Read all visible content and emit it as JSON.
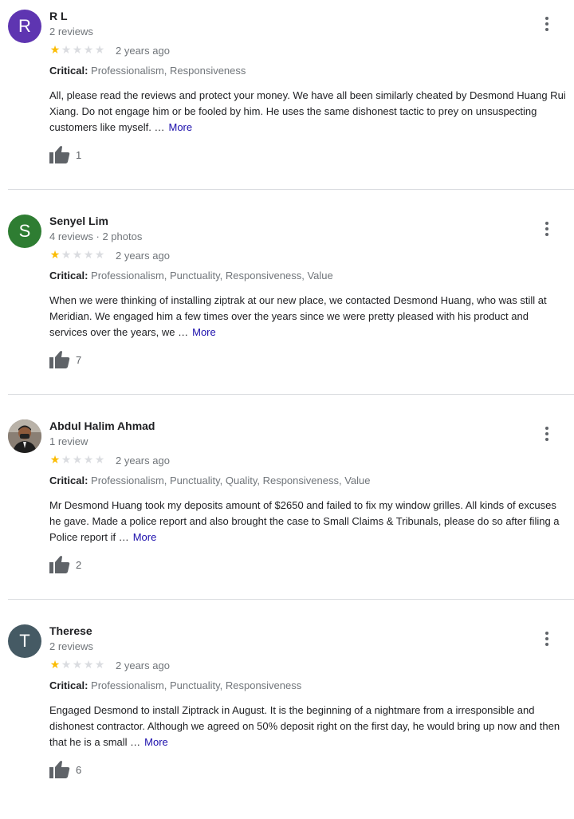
{
  "reviews": [
    {
      "avatar_letter": "R",
      "avatar_color": "#5e35b1",
      "name": "R L",
      "meta": "2 reviews",
      "rating": 1,
      "max_rating": 5,
      "time": "2 years ago",
      "critical_label": "Critical:",
      "critical_items": "Professionalism, Responsiveness",
      "text": "All, please read the reviews and protect your money. We have all been similarly cheated by Desmond Huang Rui Xiang. Do not engage him or be fooled by him. He uses the same dishonest tactic to prey on unsuspecting customers like myself. …",
      "more": "More",
      "likes": "1"
    },
    {
      "avatar_letter": "S",
      "avatar_color": "#2e7d32",
      "name": "Senyel Lim",
      "meta": "4 reviews · 2 photos",
      "rating": 1,
      "max_rating": 5,
      "time": "2 years ago",
      "critical_label": "Critical:",
      "critical_items": "Professionalism, Punctuality, Responsiveness, Value",
      "text": "When we were thinking of installing ziptrak at our new place, we contacted Desmond Huang, who was still at Meridian. We engaged him a few times over the years since we were pretty pleased with his product and services over the years, we …",
      "more": "More",
      "likes": "7"
    },
    {
      "avatar_letter": "",
      "avatar_color": "#6d6d6d",
      "name": "Abdul Halim Ahmad",
      "meta": "1 review",
      "rating": 1,
      "max_rating": 5,
      "time": "2 years ago",
      "critical_label": "Critical:",
      "critical_items": "Professionalism, Punctuality, Quality, Responsiveness, Value",
      "text": "Mr Desmond Huang took my deposits amount of $2650 and failed to fix my window grilles. All kinds of excuses he gave. Made a police report and also brought the case to Small Claims & Tribunals, please do so after filing a Police report if …",
      "more": "More",
      "likes": "2"
    },
    {
      "avatar_letter": "T",
      "avatar_color": "#455a64",
      "name": "Therese",
      "meta": "2 reviews",
      "rating": 1,
      "max_rating": 5,
      "time": "2 years ago",
      "critical_label": "Critical:",
      "critical_items": "Professionalism, Punctuality, Responsiveness",
      "text": "Engaged Desmond to install Ziptrack in August. It is the beginning of a nightmare from a irresponsible and dishonest contractor. Although we agreed on 50% deposit right on the first day, he would bring up now and then that he is a small …",
      "more": "More",
      "likes": "6"
    }
  ]
}
